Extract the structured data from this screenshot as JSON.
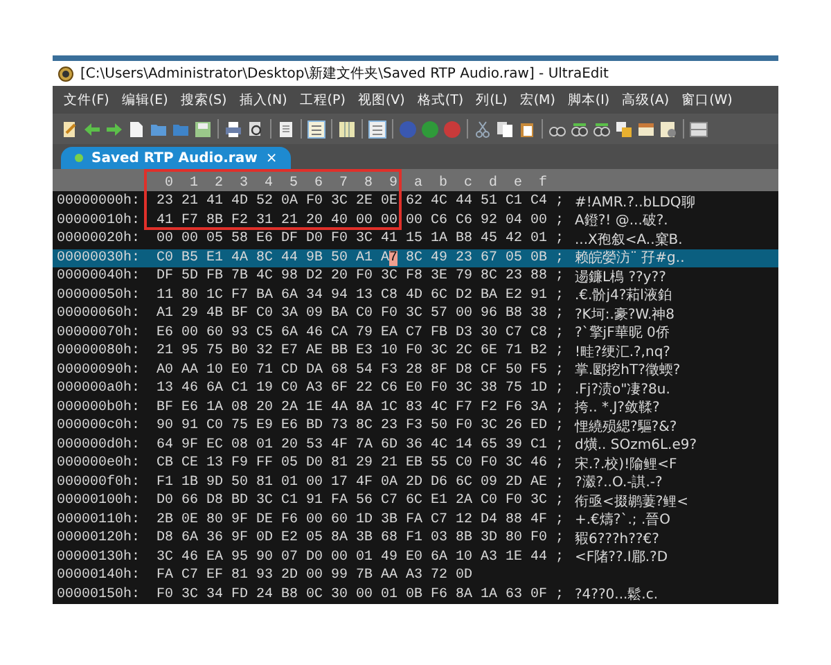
{
  "window": {
    "title": "[C:\\Users\\Administrator\\Desktop\\新建文件夹\\Saved RTP Audio.raw] - UltraEdit"
  },
  "menu": [
    "文件(F)",
    "编辑(E)",
    "搜索(S)",
    "插入(N)",
    "工程(P)",
    "视图(V)",
    "格式(T)",
    "列(L)",
    "宏(M)",
    "脚本(I)",
    "高级(A)",
    "窗口(W)"
  ],
  "tabs": [
    {
      "label": "Saved RTP Audio.raw",
      "close": "×",
      "selected": true
    }
  ],
  "column_labels": [
    "0",
    "1",
    "2",
    "3",
    "4",
    "5",
    "6",
    "7",
    "8",
    "9",
    "a",
    "b",
    "c",
    "d",
    "e",
    "f"
  ],
  "rows": [
    {
      "offset": "00000000h:",
      "bytes": [
        "23",
        "21",
        "41",
        "4D",
        "52",
        "0A",
        "F0",
        "3C",
        "2E",
        "0E",
        "62",
        "4C",
        "44",
        "51",
        "C1",
        "C4"
      ],
      "separator": ";",
      "text": "#!AMR.?..bLDQ聊",
      "selected": false
    },
    {
      "offset": "00000010h:",
      "bytes": [
        "41",
        "F7",
        "8B",
        "F2",
        "31",
        "21",
        "20",
        "40",
        "00",
        "00",
        "00",
        "C6",
        "C6",
        "92",
        "04",
        "00"
      ],
      "separator": ";",
      "text": "A鐙?! @...破?.",
      "selected": false
    },
    {
      "offset": "00000020h:",
      "bytes": [
        "00",
        "00",
        "05",
        "58",
        "E6",
        "DF",
        "D0",
        "F0",
        "3C",
        "41",
        "15",
        "1A",
        "B8",
        "45",
        "42",
        "01"
      ],
      "separator": ";",
      "text": "...X孢叙<A..窠B.",
      "selected": false
    },
    {
      "offset": "00000030h:",
      "bytes": [
        {
          "value": "C0",
          "cursor": false
        },
        {
          "value": "B5",
          "cursor": false
        },
        {
          "value": "E1",
          "cursor": false
        },
        {
          "value": "4A",
          "cursor": false
        },
        {
          "value": "8C",
          "cursor": false
        },
        {
          "value": "44",
          "cursor": false
        },
        {
          "value": "9B",
          "cursor": false
        },
        {
          "value": "50",
          "cursor": false
        },
        {
          "value": "A1",
          "cursor": false
        },
        {
          "value": "A7",
          "cursor": true
        },
        {
          "value": "8C",
          "cursor": false
        },
        {
          "value": "49",
          "cursor": false
        },
        {
          "value": "23",
          "cursor": false
        },
        {
          "value": "67",
          "cursor": false
        },
        {
          "value": "05",
          "cursor": false
        },
        {
          "value": "0B",
          "cursor": false
        }
      ],
      "separator": ";",
      "text": "赖皖嫈汸¨   孖#g..",
      "selected": true
    },
    {
      "offset": "00000040h:",
      "bytes": [
        "DF",
        "5D",
        "FB",
        "7B",
        "4C",
        "98",
        "D2",
        "20",
        "F0",
        "3C",
        "F8",
        "3E",
        "79",
        "8C",
        "23",
        "88"
      ],
      "separator": ";",
      "text": "逿鐮L樢 ??y??",
      "selected": false
    },
    {
      "offset": "00000050h:",
      "bytes": [
        "11",
        "80",
        "1C",
        "F7",
        "BA",
        "6A",
        "34",
        "94",
        "13",
        "C8",
        "4D",
        "6C",
        "D2",
        "BA",
        "E2",
        "91"
      ],
      "separator": ";",
      "text": ".€.骱j4?萂l液鉑",
      "selected": false
    },
    {
      "offset": "00000060h:",
      "bytes": [
        "A1",
        "29",
        "4B",
        "BF",
        "C0",
        "3A",
        "09",
        "BA",
        "C0",
        "F0",
        "3C",
        "57",
        "00",
        "96",
        "B8",
        "38"
      ],
      "separator": ";",
      "text": "?K坷:.豪?W.神8",
      "selected": false
    },
    {
      "offset": "00000070h:",
      "bytes": [
        "E6",
        "00",
        "60",
        "93",
        "C5",
        "6A",
        "46",
        "CA",
        "79",
        "EA",
        "C7",
        "FB",
        "D3",
        "30",
        "C7",
        "C8"
      ],
      "separator": ";",
      "text": "?`擎jF華昵  0侨",
      "selected": false
    },
    {
      "offset": "00000080h:",
      "bytes": [
        "21",
        "95",
        "75",
        "B0",
        "32",
        "E7",
        "AE",
        "BB",
        "E3",
        "10",
        "F0",
        "3C",
        "2C",
        "6E",
        "71",
        "B2"
      ],
      "separator": ";",
      "text": "!畦?绠汇.?,nq?",
      "selected": false
    },
    {
      "offset": "00000090h:",
      "bytes": [
        "A0",
        "AA",
        "10",
        "E0",
        "71",
        "CD",
        "DA",
        "68",
        "54",
        "F3",
        "28",
        "8F",
        "D8",
        "CF",
        "50",
        "F5"
      ],
      "separator": ";",
      "text": "掌.郾挖hT?徵蝡?",
      "selected": false
    },
    {
      "offset": "000000a0h:",
      "bytes": [
        "13",
        "46",
        "6A",
        "C1",
        "19",
        "C0",
        "A3",
        "6F",
        "22",
        "C6",
        "E0",
        "F0",
        "3C",
        "38",
        "75",
        "1D"
      ],
      "separator": ";",
      "text": ".Fj?渍o\"凄?8u.",
      "selected": false
    },
    {
      "offset": "000000b0h:",
      "bytes": [
        "BF",
        "E6",
        "1A",
        "08",
        "20",
        "2A",
        "1E",
        "4A",
        "8A",
        "1C",
        "83",
        "4C",
        "F7",
        "F2",
        "F6",
        "3A"
      ],
      "separator": ";",
      "text": "挎.. *.J?敛鞣?",
      "selected": false
    },
    {
      "offset": "000000c0h:",
      "bytes": [
        "90",
        "91",
        "C0",
        "75",
        "E9",
        "E6",
        "BD",
        "73",
        "8C",
        "23",
        "F3",
        "50",
        "F0",
        "3C",
        "26",
        "ED"
      ],
      "separator": ";",
      "text": "悝繞殒緦?驅?&?",
      "selected": false
    },
    {
      "offset": "000000d0h:",
      "bytes": [
        "64",
        "9F",
        "EC",
        "08",
        "01",
        "20",
        "53",
        "4F",
        "7A",
        "6D",
        "36",
        "4C",
        "14",
        "65",
        "39",
        "C1"
      ],
      "separator": ";",
      "text": "d熿.. SOzm6L.e9?",
      "selected": false
    },
    {
      "offset": "000000e0h:",
      "bytes": [
        "CB",
        "CE",
        "13",
        "F9",
        "FF",
        "05",
        "D0",
        "81",
        "29",
        "21",
        "EB",
        "55",
        "C0",
        "F0",
        "3C",
        "46"
      ],
      "separator": ";",
      "text": "宋.?.校)!隃鲤<F",
      "selected": false
    },
    {
      "offset": "000000f0h:",
      "bytes": [
        "F1",
        "1B",
        "9D",
        "50",
        "81",
        "01",
        "00",
        "17",
        "4F",
        "0A",
        "2D",
        "D6",
        "6C",
        "09",
        "2D",
        "AE"
      ],
      "separator": ";",
      "text": "?瀫?..O.-諆.-?",
      "selected": false
    },
    {
      "offset": "00000100h:",
      "bytes": [
        "D0",
        "66",
        "D8",
        "BD",
        "3C",
        "C1",
        "91",
        "FA",
        "56",
        "C7",
        "6C",
        "E1",
        "2A",
        "C0",
        "F0",
        "3C"
      ],
      "separator": ";",
      "text": "衔亟<掇鹕萋?鲤<",
      "selected": false
    },
    {
      "offset": "00000110h:",
      "bytes": [
        "2B",
        "0E",
        "80",
        "9F",
        "DE",
        "F6",
        "00",
        "60",
        "1D",
        "3B",
        "FA",
        "C7",
        "12",
        "D4",
        "88",
        "4F"
      ],
      "separator": ";",
      "text": "+.€燽?`.;  .晉O",
      "selected": false
    },
    {
      "offset": "00000120h:",
      "bytes": [
        "D8",
        "6A",
        "36",
        "9F",
        "0D",
        "E2",
        "05",
        "8A",
        "3B",
        "68",
        "F1",
        "03",
        "8B",
        "3D",
        "80",
        "F0"
      ],
      "separator": ";",
      "text": "豭6???h??€?",
      "selected": false
    },
    {
      "offset": "00000130h:",
      "bytes": [
        "3C",
        "46",
        "EA",
        "95",
        "90",
        "07",
        "D0",
        "00",
        "01",
        "49",
        "E0",
        "6A",
        "10",
        "A3",
        "1E",
        "44"
      ],
      "separator": ";",
      "text": "<F陼??.I郿.?D",
      "selected": false
    },
    {
      "offset": "00000140h:",
      "bytes": [
        "FA",
        "C7",
        "EF",
        "81",
        "93",
        "2D",
        "00",
        "99",
        "7B",
        "AA",
        "A3",
        "72",
        "0D"
      ],
      "selected": false
    },
    {
      "offset": "00000150h:",
      "bytes": [
        "F0",
        "3C",
        "34",
        "FD",
        "24",
        "B8",
        "0C",
        "30",
        "00",
        "01",
        "0B",
        "F6",
        "8A",
        "1A",
        "63",
        "0F"
      ],
      "separator": ";",
      "text": "?4??0...鬆.c.",
      "selected": false
    }
  ]
}
